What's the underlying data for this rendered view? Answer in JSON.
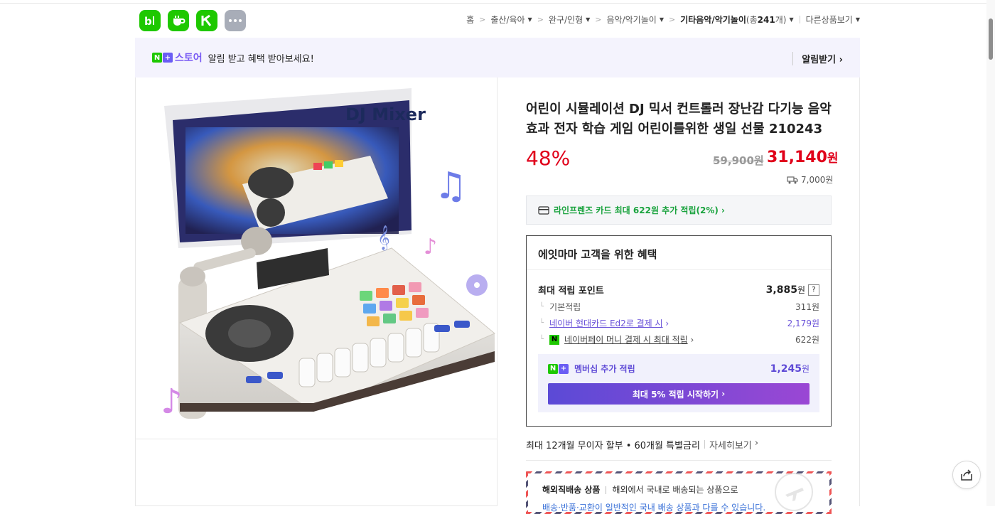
{
  "header": {
    "apps": [
      {
        "name": "blog-app-icon",
        "glyph": "b|"
      },
      {
        "name": "cafe-app-icon",
        "glyph": "☕"
      },
      {
        "name": "kream-app-icon",
        "glyph": "K"
      },
      {
        "name": "more-apps-icon",
        "glyph": "•••"
      }
    ],
    "breadcrumb": {
      "home": "홈",
      "cat1": "출산/육아",
      "cat2": "완구/인형",
      "cat3": "음악/악기놀이",
      "cat4": "기타음악/악기놀이",
      "count_prefix": "(총 ",
      "count": "241",
      "count_suffix": "개)",
      "other": "다른상품보기"
    }
  },
  "banner": {
    "store_label": "스토어",
    "text": "알림 받고 혜택 받아보세요!",
    "alarm_label": "알림받기"
  },
  "product": {
    "image_label": "DJ Mixer",
    "title": "어린이 시뮬레이션 DJ 믹서 컨트롤러 장난감 다기능 음악 효과 전자 학습 게임 어린이를위한 생일 선물 210243",
    "discount": "48%",
    "original_price": "59,900원",
    "price": "31,140",
    "price_unit": "원",
    "shipping": "7,000원"
  },
  "card_benefit": {
    "text": "라인프렌즈 카드 최대 622원 추가 적립(2%)"
  },
  "benefit_box": {
    "title": "에잇마마 고객을 위한 혜택",
    "max_points_label": "최대 적립 포인트",
    "max_points": "3,885",
    "won": "원",
    "help": "?",
    "basic_label": "기본적립",
    "basic_value": "311원",
    "card_label": "네이버 현대카드 Ed2로 결제 시",
    "card_value": "2,179원",
    "pay_label": "네이버페이 머니 결제 시 최대 적립",
    "pay_value": "622원",
    "member_label": "멤버십 추가 적립",
    "member_value": "1,245",
    "member_button": "최대 5% 적립 시작하기"
  },
  "installment": {
    "text": "최대 12개월 무이자 할부 • 60개월 특별금리",
    "more": "자세히보기"
  },
  "overseas": {
    "title": "해외직배송 상품",
    "desc": "해외에서 국내로 배송되는 상품으로",
    "note": "배송·반품·교환이 일반적인 국내 배송 상품과 다를 수 있습니다."
  },
  "colors": {
    "sale_red": "#e0001a",
    "naver_green": "#1ec800",
    "plus_purple": "#6a52d9"
  }
}
